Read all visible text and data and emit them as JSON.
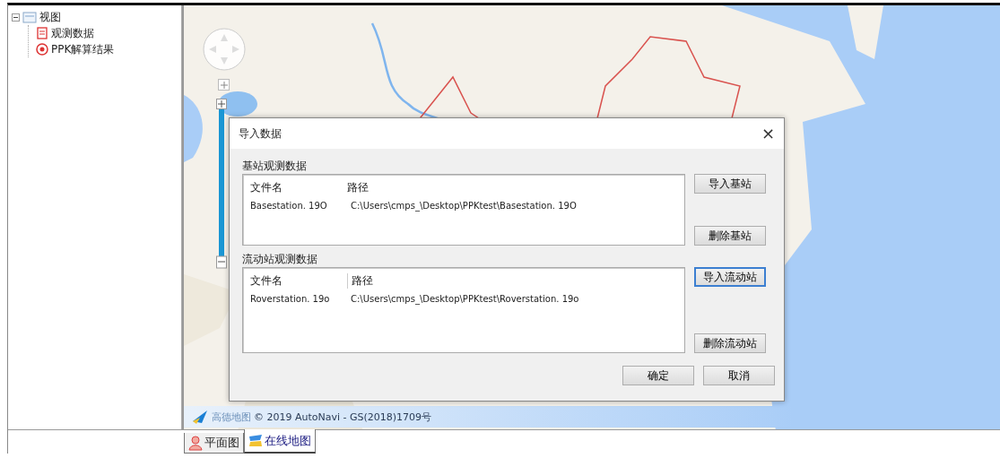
{
  "tree": [
    {
      "label": "视图",
      "expanded": true,
      "children": [
        {
          "label": "观测数据",
          "kind": "data"
        },
        {
          "label": "PPK解算结果",
          "kind": "result"
        }
      ]
    }
  ],
  "map": {
    "kind": "picture",
    "attribution_logo": "高德地图",
    "attribution": "© 2019 AutoNavi - GS(2018)1709号"
  },
  "dialog": {
    "title": "导入数据",
    "close": "×",
    "groups": [
      {
        "title": "基站观测数据",
        "columns": [
          "文件名",
          "路径"
        ],
        "rows": [
          [
            "Basestation. 19O",
            "C:\\Users\\cmps_\\Desktop\\PPKtest\\Basestation. 19O"
          ]
        ],
        "buttons": [
          {
            "label": "导入基站",
            "focused": false
          },
          {
            "label": "删除基站",
            "focused": false
          }
        ]
      },
      {
        "title": "流动站观测数据",
        "columns": [
          "文件名",
          "路径"
        ],
        "rows": [
          [
            "Roverstation. 19o",
            "C:\\Users\\cmps_\\Desktop\\PPKtest\\Roverstation. 19o"
          ]
        ],
        "buttons": [
          {
            "label": "导入流动站",
            "focused": true
          },
          {
            "label": "删除流动站",
            "focused": false
          }
        ]
      }
    ],
    "footer_buttons": [
      "确定",
      "取消"
    ]
  },
  "tabs": [
    {
      "label": "平面图",
      "kind": "plan",
      "selected": false
    },
    {
      "label": "在线地图",
      "kind": "online",
      "selected": true
    }
  ]
}
